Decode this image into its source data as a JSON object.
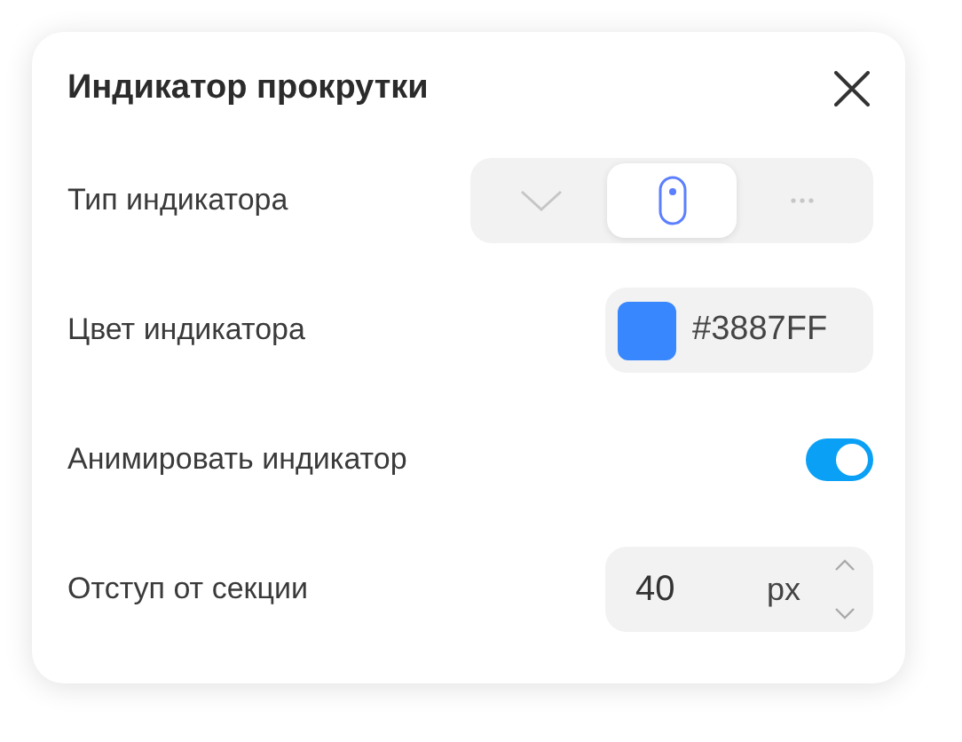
{
  "panel": {
    "title": "Индикатор прокрутки"
  },
  "rows": [
    {
      "kind": "segmented",
      "label": "Тип индикатора",
      "options": [
        {
          "kind": "chevron",
          "selected": false
        },
        {
          "kind": "mouse",
          "selected": true
        },
        {
          "kind": "dots",
          "selected": false
        }
      ]
    },
    {
      "kind": "color",
      "label": "Цвет индикатора",
      "value": "#3887FF",
      "color": "#3887ff"
    },
    {
      "kind": "toggle",
      "label": "Анимировать индикатор",
      "on": true
    },
    {
      "kind": "number",
      "label": "Отступ от секции",
      "value": "40",
      "unit": "px"
    }
  ]
}
